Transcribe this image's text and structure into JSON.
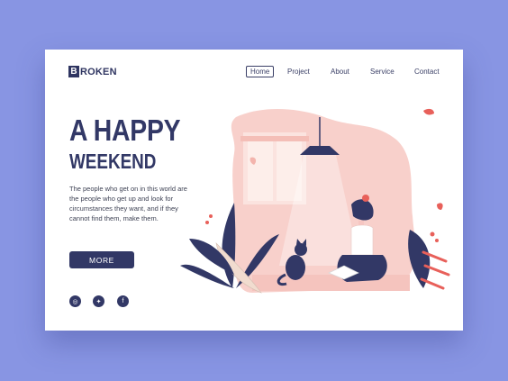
{
  "logo": {
    "letter": "B",
    "text": "ROKEN"
  },
  "nav": {
    "items": [
      {
        "label": "Home",
        "active": true
      },
      {
        "label": "Project",
        "active": false
      },
      {
        "label": "About",
        "active": false
      },
      {
        "label": "Service",
        "active": false
      },
      {
        "label": "Contact",
        "active": false
      }
    ]
  },
  "hero": {
    "title": "A HAPPY",
    "subtitle": "WEEKEND",
    "description": "The people who get on in this world are the people who get up and look for circumstances they want, and if they cannot find them, make them.",
    "button_label": "MORE"
  },
  "social": [
    {
      "icon": "instagram-icon",
      "glyph": "◎"
    },
    {
      "icon": "twitter-icon",
      "glyph": "✦"
    },
    {
      "icon": "facebook-icon",
      "glyph": "f"
    }
  ],
  "colors": {
    "background": "#8895e3",
    "primary": "#323866",
    "accent_pink": "#f6c6c2",
    "accent_red": "#e8605a"
  }
}
